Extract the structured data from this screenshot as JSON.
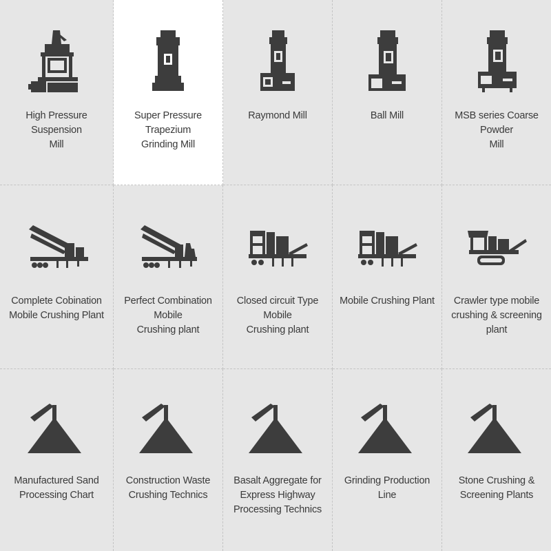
{
  "colors": {
    "background": "#e6e6e6",
    "active_background": "#ffffff",
    "icon": "#3d3d3d",
    "text": "#3a3a3a"
  },
  "products": [
    {
      "line1": "High Pressure Suspension",
      "line2": "Mill",
      "icon": "hp-suspension-mill-icon"
    },
    {
      "line1": "Super Pressure Trapezium",
      "line2": "Grinding Mill",
      "icon": "trapezium-mill-icon"
    },
    {
      "line1": "Raymond Mill",
      "line2": "",
      "icon": "raymond-mill-icon"
    },
    {
      "line1": "Ball Mill",
      "line2": "",
      "icon": "ball-mill-icon"
    },
    {
      "line1": "MSB series Coarse Powder",
      "line2": "Mill",
      "icon": "msb-mill-icon"
    },
    {
      "line1": "Complete Cobination",
      "line2": "Mobile Crushing Plant",
      "icon": "mobile-crusher-icon"
    },
    {
      "line1": "Perfect Combination Mobile",
      "line2": "Crushing plant",
      "icon": "mobile-crusher-icon"
    },
    {
      "line1": "Closed circuit Type Mobile",
      "line2": "Crushing plant",
      "icon": "mobile-crusher-truck-icon"
    },
    {
      "line1": "Mobile Crushing Plant",
      "line2": "",
      "icon": "mobile-crusher-truck-icon"
    },
    {
      "line1": "Crawler type mobile",
      "line2": "crushing & screening plant",
      "icon": "crawler-crusher-icon"
    },
    {
      "line1": "Manufactured Sand",
      "line2": "Processing Chart",
      "icon": "stockpile-conveyor-icon"
    },
    {
      "line1": "Construction Waste",
      "line2": "Crushing Technics",
      "icon": "stockpile-conveyor-icon"
    },
    {
      "line1": "Basalt Aggregate for",
      "line2": "Express Highway",
      "line3": "Processing Technics",
      "icon": "stockpile-conveyor-icon"
    },
    {
      "line1": "Grinding Production Line",
      "line2": "",
      "icon": "stockpile-conveyor-icon"
    },
    {
      "line1": "Stone Crushing &",
      "line2": "Screening Plants",
      "icon": "stockpile-conveyor-icon"
    }
  ]
}
